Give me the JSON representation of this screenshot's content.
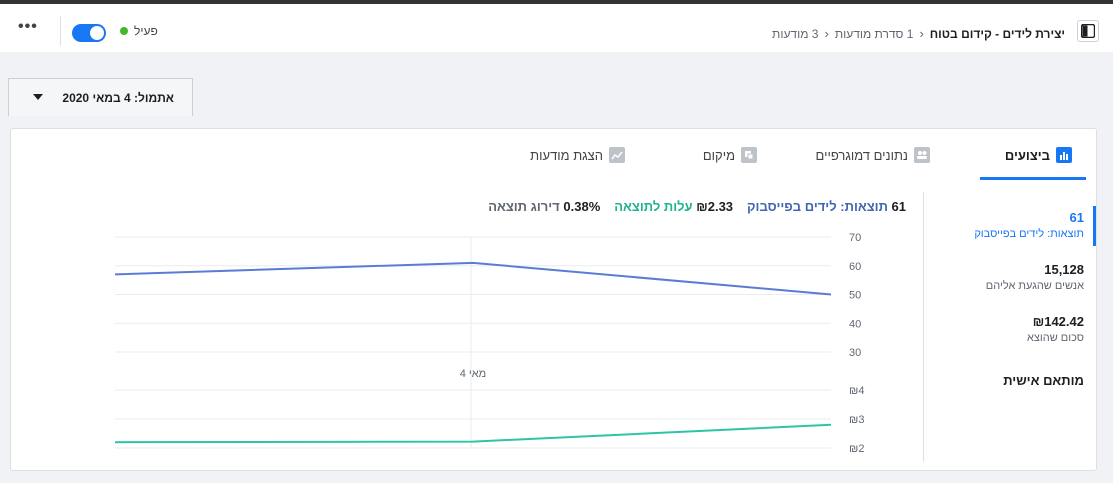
{
  "header": {
    "breadcrumb_current": "יצירת לידים - קידום בטוח",
    "breadcrumb_ad_sets": "1 סדרת מודעות",
    "breadcrumb_ads": "3 מודעות",
    "status_label": "פעיל",
    "more_label": "•••",
    "colors": {
      "accent": "#1877f2",
      "active_dot": "#42b72a"
    }
  },
  "date_selector": {
    "label": "אתמול: 4 במאי 2020"
  },
  "tabs": [
    {
      "label": "ביצועים",
      "icon": "bar-chart-icon",
      "active": true
    },
    {
      "label": "נתונים דמוגרפיים",
      "icon": "people-icon",
      "active": false
    },
    {
      "label": "מיקום",
      "icon": "placement-icon",
      "active": false
    },
    {
      "label": "הצגת מודעות",
      "icon": "trend-icon",
      "active": false
    }
  ],
  "sidebar": {
    "metrics": [
      {
        "value": "61",
        "label": "תוצאות: לידים בפייסבוק",
        "selected": true
      },
      {
        "value": "15,128",
        "label": "אנשים שהגעת אליהם",
        "selected": false
      },
      {
        "value": "₪142.42",
        "label": "סכום שהוצא",
        "selected": false
      }
    ],
    "custom_label": "מותאם אישית"
  },
  "summary": {
    "results_value": "61",
    "results_label": "תוצאות: לידים בפייסבוק",
    "cost_value": "₪2.33",
    "cost_label": "עלות לתוצאה",
    "rank_value": "0.38%",
    "rank_label": "דירוג תוצאה"
  },
  "chart_data": [
    {
      "type": "line",
      "series": [
        {
          "name": "תוצאות: לידים בפייסבוק",
          "color": "#5b7bd5",
          "values": [
            57,
            61,
            50
          ]
        }
      ],
      "x": [
        "",
        "מאי 4",
        ""
      ],
      "ylim": [
        30,
        70
      ],
      "yticks": [
        "70",
        "60",
        "50",
        "40",
        "30"
      ],
      "grid": true
    },
    {
      "type": "line",
      "series": [
        {
          "name": "עלות לתוצאה",
          "color": "#2ec4a6",
          "values": [
            2.2,
            2.22,
            2.8
          ]
        }
      ],
      "x": [
        "",
        "",
        ""
      ],
      "ylim": [
        2,
        4
      ],
      "yticks": [
        "₪4",
        "₪3",
        "₪2"
      ],
      "grid": true
    }
  ]
}
